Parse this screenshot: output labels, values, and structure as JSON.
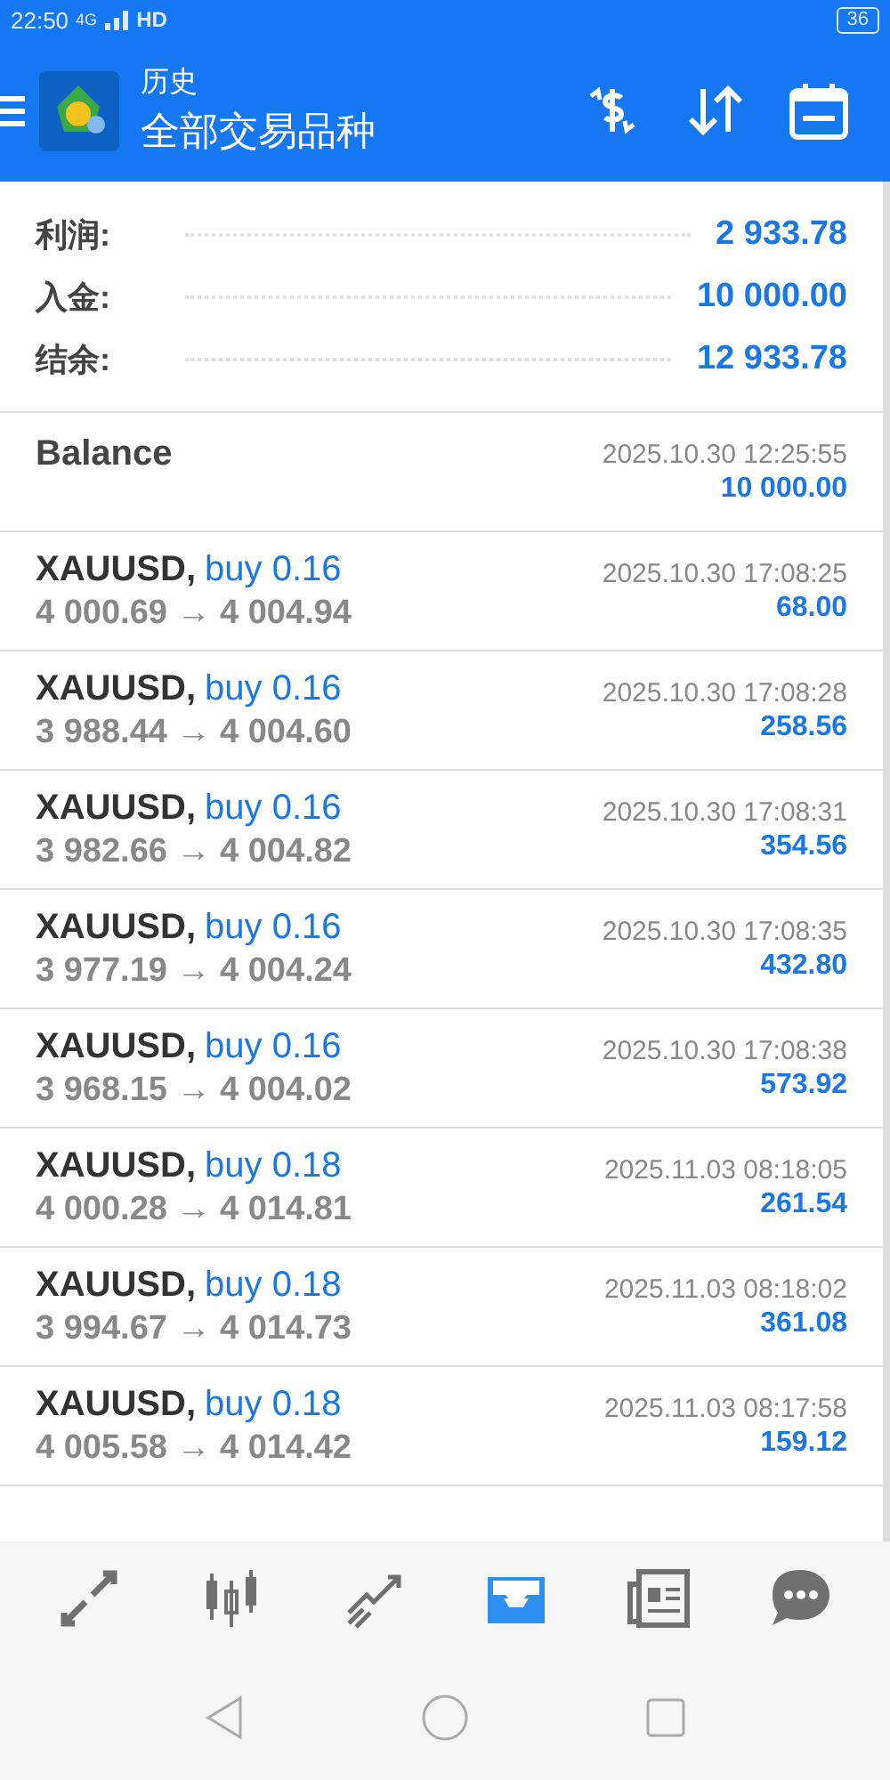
{
  "status_bar": {
    "time": "22:50",
    "network": "4G",
    "hd": "HD",
    "battery": "36"
  },
  "header": {
    "title": "历史",
    "subtitle": "全部交易品种"
  },
  "summary": [
    {
      "label": "利润:",
      "value": "2 933.78"
    },
    {
      "label": "入金:",
      "value": "10 000.00"
    },
    {
      "label": "结余:",
      "value": "12 933.78"
    }
  ],
  "balance": {
    "label": "Balance",
    "time": "2025.10.30 12:25:55",
    "amount": "10 000.00"
  },
  "trades": [
    {
      "symbol": "XAUUSD,",
      "side": "buy 0.16",
      "prices": "4 000.69 → 4 004.94",
      "time": "2025.10.30 17:08:25",
      "profit": "68.00"
    },
    {
      "symbol": "XAUUSD,",
      "side": "buy 0.16",
      "prices": "3 988.44 → 4 004.60",
      "time": "2025.10.30 17:08:28",
      "profit": "258.56"
    },
    {
      "symbol": "XAUUSD,",
      "side": "buy 0.16",
      "prices": "3 982.66 → 4 004.82",
      "time": "2025.10.30 17:08:31",
      "profit": "354.56"
    },
    {
      "symbol": "XAUUSD,",
      "side": "buy 0.16",
      "prices": "3 977.19 → 4 004.24",
      "time": "2025.10.30 17:08:35",
      "profit": "432.80"
    },
    {
      "symbol": "XAUUSD,",
      "side": "buy 0.16",
      "prices": "3 968.15 → 4 004.02",
      "time": "2025.10.30 17:08:38",
      "profit": "573.92"
    },
    {
      "symbol": "XAUUSD,",
      "side": "buy 0.18",
      "prices": "4 000.28 → 4 014.81",
      "time": "2025.11.03 08:18:05",
      "profit": "261.54"
    },
    {
      "symbol": "XAUUSD,",
      "side": "buy 0.18",
      "prices": "3 994.67 → 4 014.73",
      "time": "2025.11.03 08:18:02",
      "profit": "361.08"
    },
    {
      "symbol": "XAUUSD,",
      "side": "buy 0.18",
      "prices": "4 005.58 → 4 014.42",
      "time": "2025.11.03 08:17:58",
      "profit": "159.12"
    }
  ],
  "bottom_nav": [
    {
      "kind": "quotes",
      "selected": false
    },
    {
      "kind": "chart",
      "selected": false
    },
    {
      "kind": "trade",
      "selected": false
    },
    {
      "kind": "history",
      "selected": true
    },
    {
      "kind": "news",
      "selected": false
    },
    {
      "kind": "chat",
      "selected": false
    }
  ]
}
